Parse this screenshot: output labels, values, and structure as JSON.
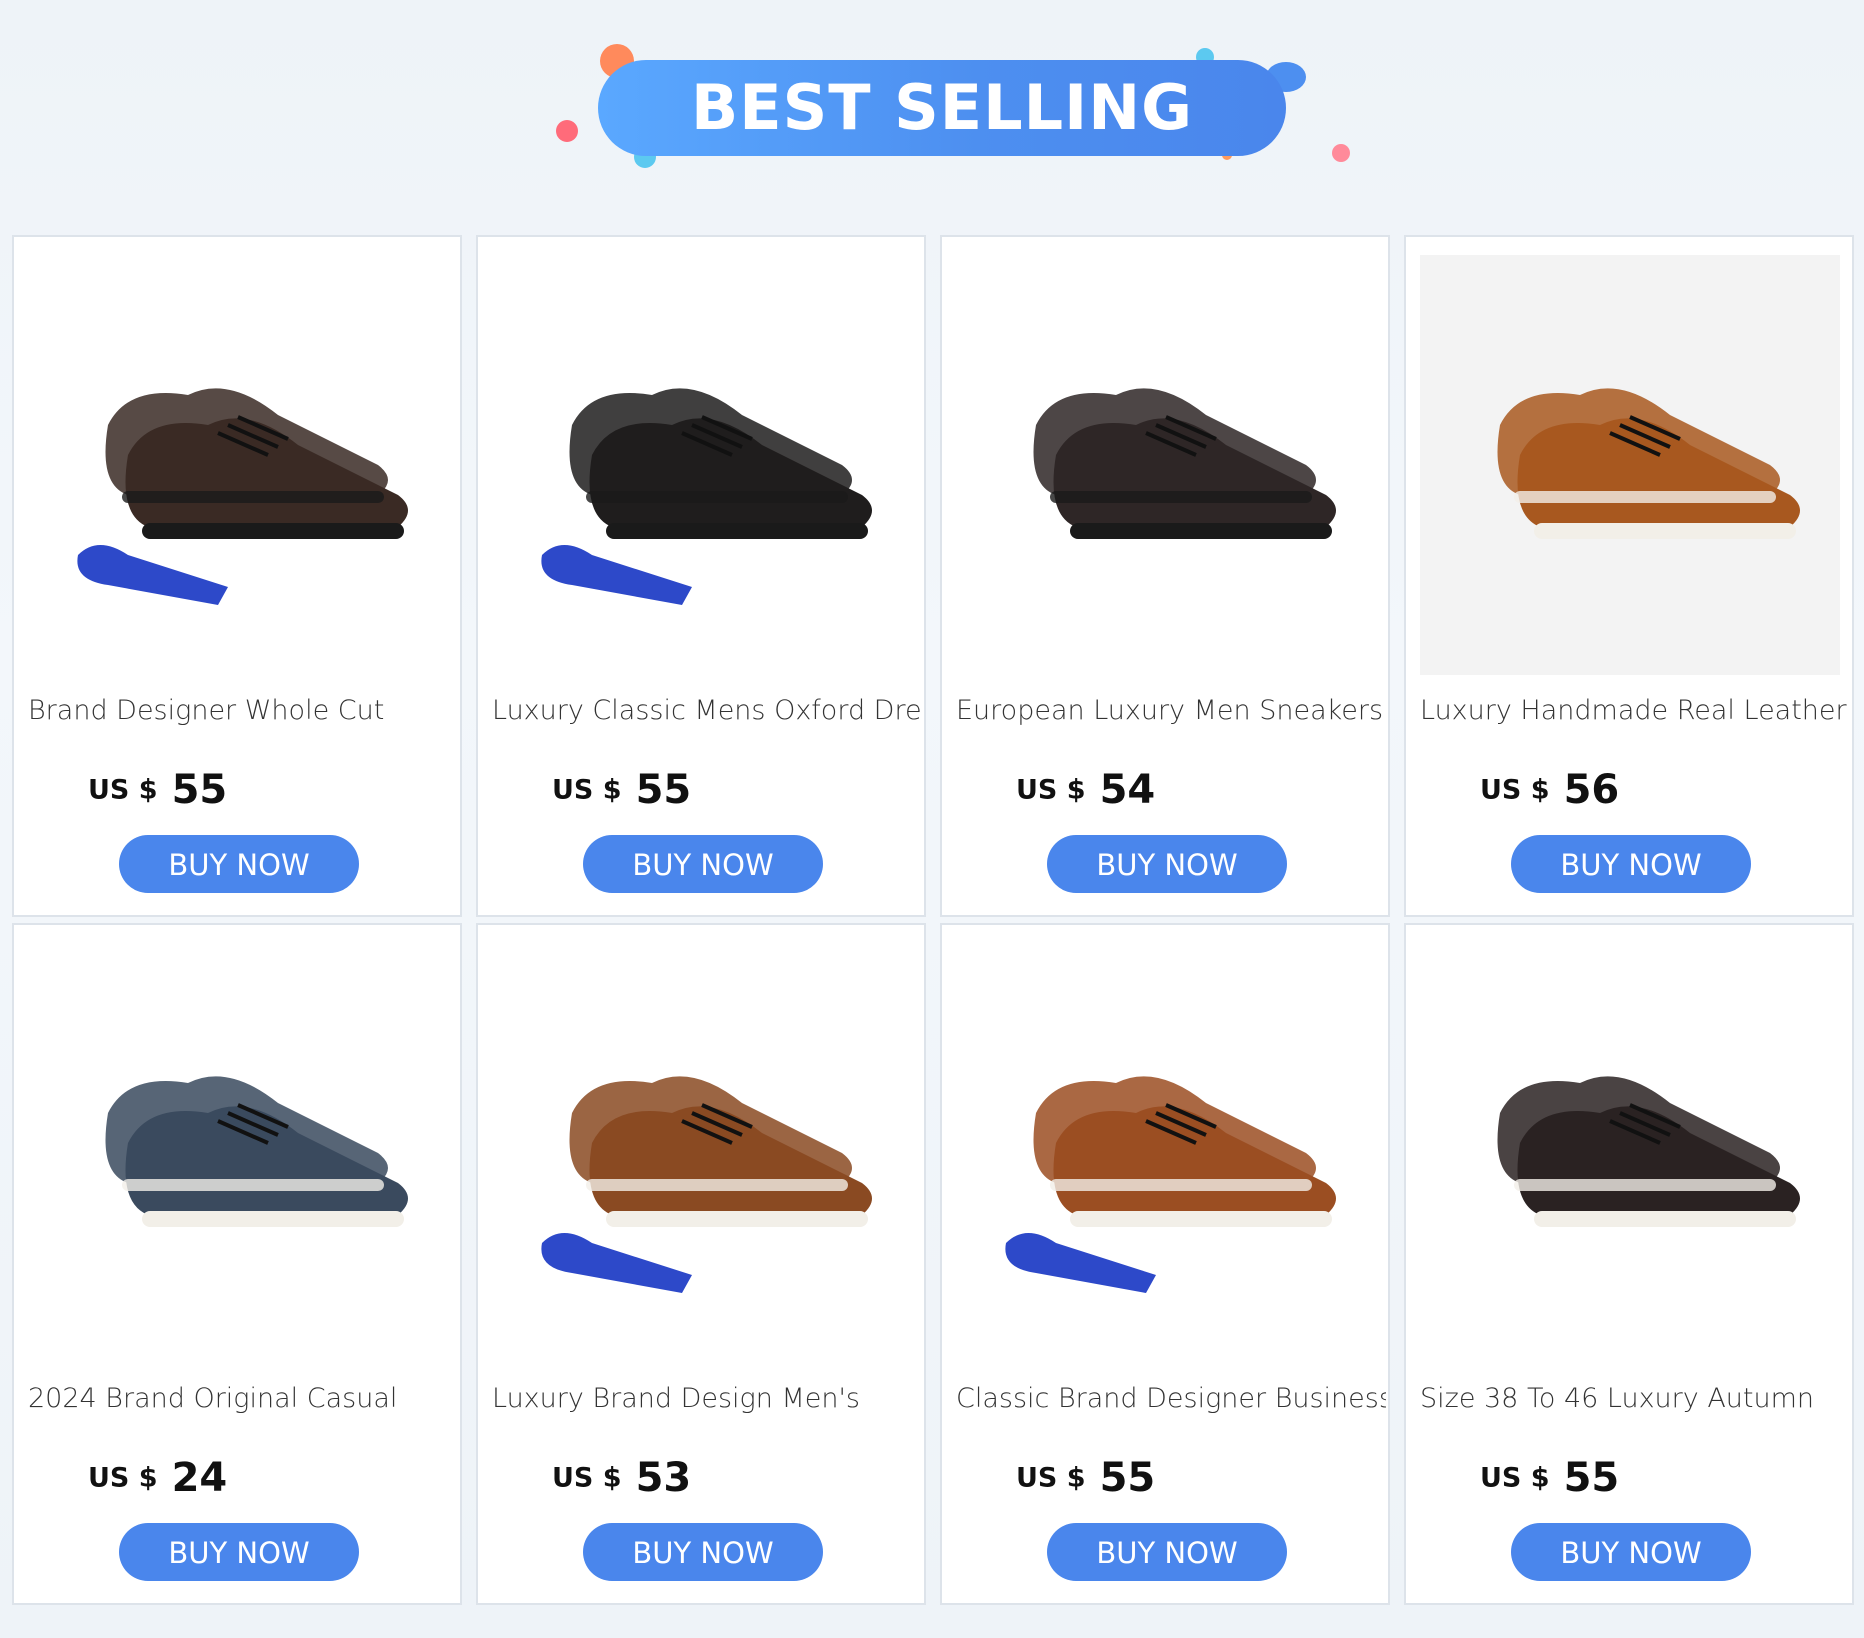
{
  "banner": {
    "title": "BEST SELLING"
  },
  "products": [
    {
      "title": "Brand Designer Whole Cut",
      "currency": "US $",
      "price": "55",
      "cta": "BUY NOW",
      "icon": "oxford-shoe-icon",
      "color": "#3a2a24",
      "tie": true
    },
    {
      "title": "Luxury Classic Mens Oxford Dress",
      "currency": "US $",
      "price": "55",
      "cta": "BUY NOW",
      "icon": "oxford-shoe-icon",
      "color": "#1f1d1d",
      "tie": true
    },
    {
      "title": "European Luxury Men Sneakers",
      "currency": "US $",
      "price": "54",
      "cta": "BUY NOW",
      "icon": "monk-strap-shoe-icon",
      "color": "#2e2626",
      "tie": false
    },
    {
      "title": "Luxury Handmade Real Leather",
      "currency": "US $",
      "price": "56",
      "cta": "BUY NOW",
      "icon": "leather-sneaker-icon",
      "color": "#a8581f",
      "tie": false
    },
    {
      "title": "2024 Brand Original Casual",
      "currency": "US $",
      "price": "24",
      "cta": "BUY NOW",
      "icon": "boat-shoe-icon",
      "color": "#3a4a5e",
      "tie": false
    },
    {
      "title": "Luxury Brand Design Men's",
      "currency": "US $",
      "price": "53",
      "cta": "BUY NOW",
      "icon": "sneaker-icon",
      "color": "#8a4a22",
      "tie": true
    },
    {
      "title": "Classic Brand Designer Business",
      "currency": "US $",
      "price": "55",
      "cta": "BUY NOW",
      "icon": "sneaker-icon",
      "color": "#9b4e22",
      "tie": true
    },
    {
      "title": "Size 38 To 46 Luxury Autumn",
      "currency": "US $",
      "price": "55",
      "cta": "BUY NOW",
      "icon": "woven-sneaker-icon",
      "color": "#2a2222",
      "tie": false
    }
  ]
}
